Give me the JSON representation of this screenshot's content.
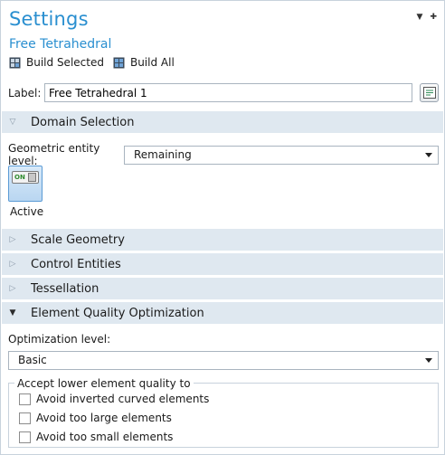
{
  "header": {
    "title": "Settings",
    "subtitle": "Free Tetrahedral",
    "window_controls": [
      "▼",
      "✚"
    ]
  },
  "toolbar": {
    "build_selected": "Build Selected",
    "build_all": "Build All"
  },
  "label_field": {
    "caption": "Label:",
    "value": "Free Tetrahedral 1"
  },
  "sections": {
    "domain_selection": "Domain Selection",
    "scale_geometry": "Scale Geometry",
    "control_entities": "Control Entities",
    "tessellation": "Tessellation",
    "element_quality": "Element Quality Optimization"
  },
  "domain": {
    "entity_level_label": "Geometric entity level:",
    "entity_level_value": "Remaining",
    "toggle_text": "ON",
    "active_label": "Active"
  },
  "optimization": {
    "level_label": "Optimization level:",
    "level_value": "Basic",
    "group_title": "Accept lower element quality to",
    "options": [
      "Avoid inverted curved elements",
      "Avoid too large elements",
      "Avoid too small elements"
    ]
  },
  "colors": {
    "accent": "#2a8fd0",
    "section_bg": "#dfe8f0"
  }
}
